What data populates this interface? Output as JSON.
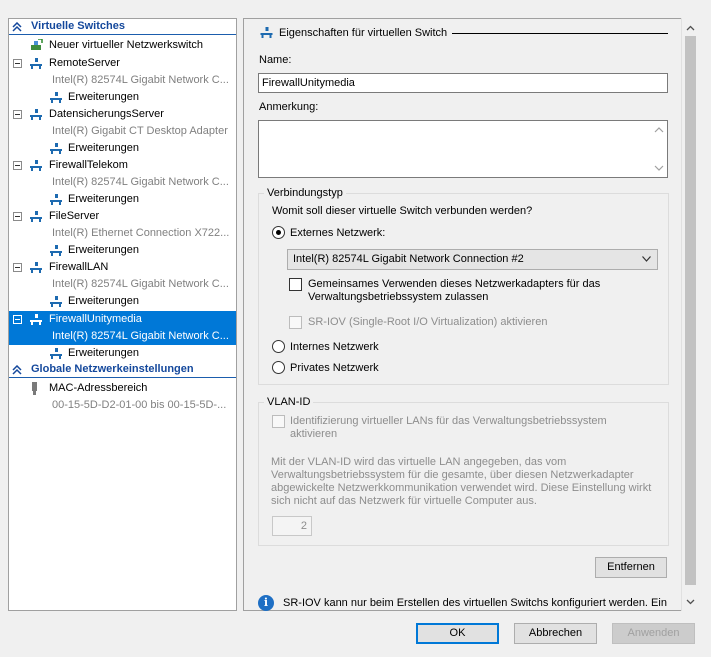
{
  "tree": {
    "virtual_switches_header": "Virtuelle Switches",
    "new_switch": "Neuer virtueller Netzwerkswitch",
    "switches": [
      {
        "name": "RemoteServer",
        "adapter": "Intel(R) 82574L Gigabit Network C...",
        "extensions": "Erweiterungen"
      },
      {
        "name": "DatensicherungsServer",
        "adapter": "Intel(R) Gigabit CT Desktop Adapter",
        "extensions": "Erweiterungen"
      },
      {
        "name": "FirewallTelekom",
        "adapter": "Intel(R) 82574L Gigabit Network C...",
        "extensions": "Erweiterungen"
      },
      {
        "name": "FileServer",
        "adapter": "Intel(R) Ethernet Connection X722...",
        "extensions": "Erweiterungen"
      },
      {
        "name": "FirewallLAN",
        "adapter": "Intel(R) 82574L Gigabit Network C...",
        "extensions": "Erweiterungen"
      },
      {
        "name": "FirewallUnitymedia",
        "adapter": "Intel(R) 82574L Gigabit Network C...",
        "extensions": "Erweiterungen"
      }
    ],
    "global_header": "Globale Netzwerkeinstellungen",
    "mac_range": "MAC-Adressbereich",
    "mac_value": "00-15-5D-D2-01-00 bis 00-15-5D-..."
  },
  "properties": {
    "title": "Eigenschaften für virtuellen Switch",
    "name_label": "Name:",
    "name_value": "FirewallUnitymedia",
    "note_label": "Anmerkung:",
    "note_value": ""
  },
  "connection": {
    "group_title": "Verbindungstyp",
    "question": "Womit soll dieser virtuelle Switch verbunden werden?",
    "external_label": "Externes Netzwerk:",
    "adapter_selected": "Intel(R) 82574L Gigabit Network Connection #2",
    "shared_label_1": "Gemeinsames Verwenden dieses Netzwerkadapters für das",
    "shared_label_2": "Verwaltungsbetriebssystem zulassen",
    "sriov_label": "SR-IOV (Single-Root I/O Virtualization) aktivieren",
    "internal_label": "Internes Netzwerk",
    "private_label": "Privates Netzwerk",
    "selected": "external"
  },
  "vlan": {
    "group_title": "VLAN-ID",
    "enable_label_1": "Identifizierung virtueller LANs für das Verwaltungsbetriebssystem",
    "enable_label_2": "aktivieren",
    "description": "Mit der VLAN-ID wird das virtuelle LAN angegeben, das vom Verwaltungsbetriebssystem für die gesamte, über diesen Netzwerkadapter abgewickelte Netzwerkkommunikation verwendet wird. Diese Einstellung wirkt sich nicht auf das Netzwerk für virtuelle Computer aus.",
    "id_value": "2"
  },
  "remove_button": "Entfernen",
  "info_text": "SR-IOV kann nur beim Erstellen des virtuellen Switchs konfiguriert werden. Ein",
  "footer": {
    "ok": "OK",
    "cancel": "Abbrechen",
    "apply": "Anwenden"
  },
  "colors": {
    "selection": "#0078d7",
    "section_header": "#14489c",
    "info_icon": "#1e6fc4"
  }
}
